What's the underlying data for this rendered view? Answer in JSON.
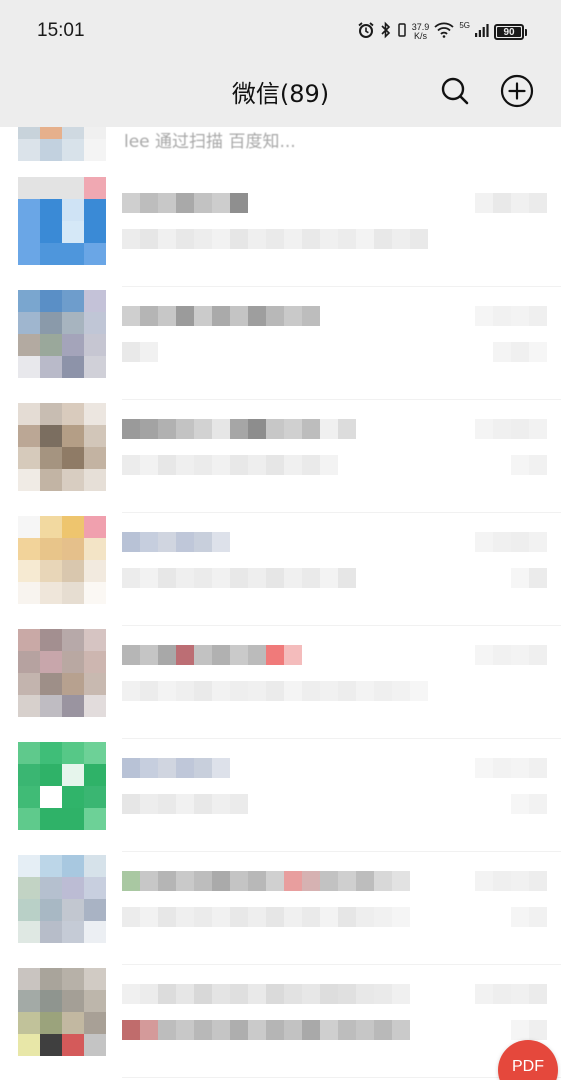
{
  "status_bar": {
    "time": "15:01",
    "net_speed_value": "37.9",
    "net_speed_unit": "K/s",
    "network": "5G",
    "battery": "90"
  },
  "header": {
    "title": "微信(89)",
    "icons": [
      "search-icon",
      "add-icon"
    ]
  },
  "chat_list": {
    "first_row_preview": "lee 通过扫描 百度知...",
    "rows": [
      {
        "avatar": [
          "#e3e3e3",
          "#e3e3e3",
          "#e3e3e3",
          "#f0a8b2",
          "#6aa6e6",
          "#3a8ad6",
          "#cfe3f5",
          "#3a8ad6",
          "#6aa6e6",
          "#3a8ad6",
          "#d5e8f7",
          "#3a8ad6",
          "#6aa6e6",
          "#4e96dc",
          "#4e96dc",
          "#6aa6e6"
        ],
        "name": [
          "#cfcfcf",
          "#bdbdbd",
          "#c8c8c8",
          "#a9a9a9",
          "#c2c2c2",
          "#cdcdcd",
          "#8f8f8f"
        ],
        "msg": [
          "#ececec",
          "#e6e6e6",
          "#f0f0f0",
          "#e8e8e8",
          "#ededed",
          "#f2f2f2",
          "#e6e6e6",
          "#efefef",
          "#eaeaea",
          "#f1f1f1",
          "#e9e9e9",
          "#f0f0f0",
          "#ececec",
          "#f3f3f3",
          "#e8e8e8",
          "#eeeeee",
          "#e9e9e9"
        ],
        "time": [
          "#f2f2f2",
          "#e9e9e9",
          "#f0f0f0",
          "#ebebeb"
        ],
        "badge": []
      },
      {
        "avatar": [
          "#7aa6cf",
          "#5a8fc6",
          "#6e9dcc",
          "#c4c2d8",
          "#9fb6cf",
          "#8a9aaa",
          "#a7b4bf",
          "#c0c6d6",
          "#b3aaa1",
          "#9aa89b",
          "#a4a4ba",
          "#c6c6d2",
          "#e8e8ec",
          "#b9bac9",
          "#8d93a9",
          "#d0d0d8"
        ],
        "name": [
          "#cfcfcf",
          "#b5b5b5",
          "#c7c7c7",
          "#9b9b9b",
          "#cbcbcb",
          "#aaaaaa",
          "#c4c4c4",
          "#9e9e9e",
          "#b8b8b8",
          "#c9c9c9",
          "#bdbdbd"
        ],
        "msg": [
          "#e9e9e9",
          "#f1f1f1"
        ],
        "time": [
          "#f5f5f5",
          "#f1f1f1",
          "#f3f3f3",
          "#efefef"
        ],
        "badge": [
          "#f4f4f4",
          "#f0f0f0",
          "#f6f6f6"
        ]
      },
      {
        "avatar": [
          "#e4dcd4",
          "#c8bdb2",
          "#d9cbbd",
          "#ece6e0",
          "#bba795",
          "#7b6e60",
          "#b49e86",
          "#d2c6b9",
          "#d6cabb",
          "#a59480",
          "#8f7b66",
          "#c3b3a2",
          "#f0ebe5",
          "#c2b4a4",
          "#d8cdc1",
          "#e6dfd7"
        ],
        "name": [
          "#9a9a9a",
          "#a3a3a3",
          "#b1b1b1",
          "#c3c3c3",
          "#d2d2d2",
          "#e6e6e6",
          "#a6a6a6",
          "#8d8d8d",
          "#c7c7c7",
          "#d0d0d0",
          "#bdbdbd",
          "#f0f0f0",
          "#dcdcdc"
        ],
        "msg": [
          "#ececec",
          "#f2f2f2",
          "#e7e7e7",
          "#efefef",
          "#ebebeb",
          "#f1f1f1",
          "#e8e8e8",
          "#eeeeee",
          "#e6e6e6",
          "#f0f0f0",
          "#eaeaea",
          "#f3f3f3"
        ],
        "time": [
          "#f4f4f4",
          "#f0f0f0",
          "#eeeeee",
          "#f2f2f2"
        ],
        "badge": [
          "#f5f5f5",
          "#f1f1f1"
        ]
      },
      {
        "avatar": [
          "#f6f6f6",
          "#f2d9a0",
          "#eec56e",
          "#f0a0ae",
          "#f2d39a",
          "#e8c58a",
          "#e5c08b",
          "#f3e4c6",
          "#f6ead2",
          "#e8d6b8",
          "#d9c7ae",
          "#f2eadf",
          "#f8f4ef",
          "#efe6da",
          "#e6ddd1",
          "#fbf8f4"
        ],
        "name": [
          "#b8c2d6",
          "#c6cede",
          "#d0d5e0",
          "#bfc7d9",
          "#c8cfdc",
          "#dde1ea"
        ],
        "msg": [
          "#ececec",
          "#f2f2f2",
          "#e7e7e7",
          "#efefef",
          "#ebebeb",
          "#f1f1f1",
          "#e8e8e8",
          "#eeeeee",
          "#e6e6e6",
          "#f0f0f0",
          "#eaeaea",
          "#f3f3f3",
          "#e6e6e6"
        ],
        "time": [
          "#f4f4f4",
          "#f0f0f0",
          "#eeeeee",
          "#f2f2f2"
        ],
        "badge": [
          "#f6f6f6",
          "#ebebeb"
        ]
      },
      {
        "avatar": [
          "#c9a9a6",
          "#a38f90",
          "#b7a9a9",
          "#d6c4c2",
          "#b6a2a0",
          "#c8a6ab",
          "#b9a8a2",
          "#cdb6b0",
          "#c3b4ae",
          "#9e8f88",
          "#b7a18f",
          "#c8b9b0",
          "#d7d0cc",
          "#bfbcc2",
          "#9a94a0",
          "#e2dcdc"
        ],
        "name": [
          "#b6b6b6",
          "#c5c5c5",
          "#a8a8a8",
          "#bc6e74",
          "#c2c2c2",
          "#b1b1b1",
          "#cacaca",
          "#bbbbbb",
          "#f07a7a",
          "#f4bcbc"
        ],
        "msg": [
          "#f1f1f1",
          "#ececec",
          "#f3f3f3",
          "#efefef",
          "#eaeaea",
          "#f2f2f2",
          "#eeeeee",
          "#f0f0f0",
          "#ebebeb",
          "#f4f4f4",
          "#eeeeee",
          "#f1f1f1",
          "#ededed",
          "#f3f3f3",
          "#efefef",
          "#f2f2f2",
          "#f6f6f6"
        ],
        "time": [
          "#f5f5f5",
          "#f1f1f1",
          "#f3f3f3",
          "#efefef"
        ],
        "badge": []
      },
      {
        "avatar": [
          "#5fc98c",
          "#3fbe78",
          "#56c887",
          "#6dd197",
          "#3ab672",
          "#2fb268",
          "#e6f5ec",
          "#2fb268",
          "#40bb76",
          "#ffffff",
          "#30b46a",
          "#3ab672",
          "#5fca8c",
          "#2fb268",
          "#2fb268",
          "#6dd197"
        ],
        "name": [
          "#b8c2d6",
          "#c6cede",
          "#d0d5e0",
          "#bfc7d9",
          "#c8cfdc",
          "#dde1ea"
        ],
        "msg": [
          "#e6e6e6",
          "#ededed",
          "#e9e9e9",
          "#f1f1f1",
          "#e8e8e8",
          "#efefef",
          "#ebebeb"
        ],
        "time": [
          "#f6f6f6",
          "#f2f2f2",
          "#f4f4f4",
          "#f0f0f0"
        ],
        "badge": [
          "#f6f6f6",
          "#f2f2f2"
        ]
      },
      {
        "avatar": [
          "#e5eef5",
          "#bcd6e8",
          "#a8c8e0",
          "#d6e2ea",
          "#c2d3c4",
          "#b5c0cf",
          "#bcbcd4",
          "#c8cfdf",
          "#b9d0c7",
          "#a8b8c4",
          "#c2c7d0",
          "#a9b3c4",
          "#dfe8e3",
          "#b7bdc9",
          "#c5cbd6",
          "#eceff3"
        ],
        "name": [
          "#a9c8a2",
          "#c7c7c7",
          "#b5b5b5",
          "#c9c9c9",
          "#bdbdbd",
          "#aaaaaa",
          "#c4c4c4",
          "#b8b8b8",
          "#d0d0d0",
          "#e89e9e",
          "#d6b2b2",
          "#c2c2c2",
          "#cfcfcf",
          "#bdbdbd",
          "#d8d8d8",
          "#e2e2e2"
        ],
        "msg": [
          "#ececec",
          "#f2f2f2",
          "#e7e7e7",
          "#efefef",
          "#ebebeb",
          "#f1f1f1",
          "#e8e8e8",
          "#eeeeee",
          "#e6e6e6",
          "#f0f0f0",
          "#eaeaea",
          "#f3f3f3",
          "#e6e6e6",
          "#eeeeee",
          "#f1f1f1",
          "#f5f5f5"
        ],
        "time": [
          "#f3f3f3",
          "#efefef",
          "#f1f1f1",
          "#ededed"
        ],
        "badge": [
          "#f5f5f5",
          "#f1f1f1"
        ]
      },
      {
        "avatar": [
          "#c9c4c0",
          "#a9a49b",
          "#b7b1a8",
          "#d1cbc4",
          "#a3aaa6",
          "#8f958f",
          "#a49f96",
          "#bdb6ab",
          "#c1c29a",
          "#9ba37c",
          "#c2b8a1",
          "#a8a096",
          "#e8e7a8",
          "#3f3f3f",
          "#d45a5a",
          "#c4c4c4"
        ],
        "name": [
          "#f0f0f0",
          "#ececec",
          "#dcdcdc",
          "#e6e6e6",
          "#d8d8d8",
          "#e4e4e4",
          "#dfdfdf",
          "#e9e9e9",
          "#dadada",
          "#e2e2e2",
          "#e7e7e7",
          "#dddddd",
          "#e0e0e0",
          "#e8e8e8",
          "#eaeaea",
          "#f0f0f0"
        ],
        "msg": [
          "#c06c6c",
          "#d49a9a",
          "#bdbdbd",
          "#c8c8c8",
          "#b8b8b8",
          "#c5c5c5",
          "#aeaeae",
          "#cacaca",
          "#b5b5b5",
          "#c2c2c2",
          "#a9a9a9",
          "#cfcfcf",
          "#bdbdbd",
          "#c6c6c6",
          "#b9b9b9",
          "#cacaca"
        ],
        "time": [
          "#f2f2f2",
          "#eeeeee",
          "#f0f0f0",
          "#ebebeb"
        ],
        "badge": [
          "#f5f5f5",
          "#efefef"
        ]
      }
    ]
  },
  "fab": {
    "label": "PDF",
    "color": "#e5483c"
  },
  "colors": {
    "header_bg": "#ededed",
    "list_bg": "#ffffff",
    "title_text": "#111111"
  }
}
